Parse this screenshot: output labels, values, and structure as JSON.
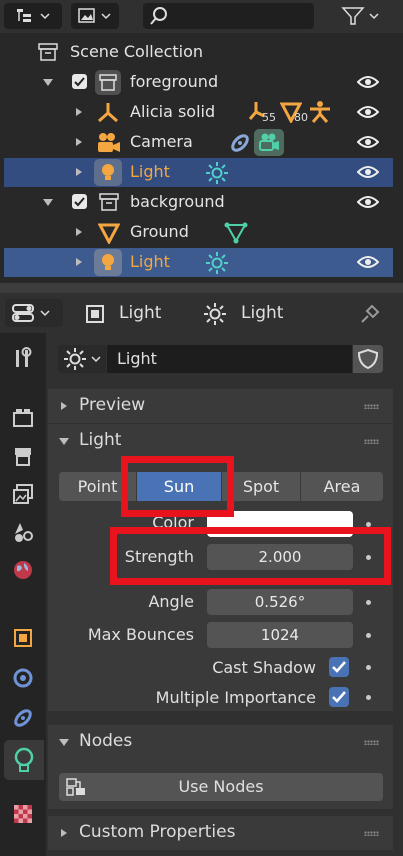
{
  "outliner": {
    "header": {
      "filter_label": ""
    },
    "rows": [
      {
        "label": "Scene Collection"
      },
      {
        "label": "foreground"
      },
      {
        "label": "Alicia solid",
        "badge1": "55",
        "badge2": "80"
      },
      {
        "label": "Camera"
      },
      {
        "label": "Light"
      },
      {
        "label": "background"
      },
      {
        "label": "Ground"
      },
      {
        "label": "Light"
      }
    ]
  },
  "properties": {
    "breadcrumb": {
      "object": "Light",
      "data": "Light"
    },
    "datablock_name": "Light",
    "panels": {
      "preview": "Preview",
      "light": "Light",
      "nodes": "Nodes",
      "custom": "Custom Properties"
    },
    "light_types": [
      "Point",
      "Sun",
      "Spot",
      "Area"
    ],
    "active_type": "Sun",
    "fields": {
      "color_label": "Color",
      "strength_label": "Strength",
      "strength_value": "2.000",
      "angle_label": "Angle",
      "angle_value": "0.526°",
      "bounces_label": "Max Bounces",
      "bounces_value": "1024",
      "cast_shadow_label": "Cast Shadow",
      "mis_label": "Multiple Importance"
    },
    "use_nodes_label": "Use Nodes"
  },
  "colors": {
    "selected_row": "#334d80",
    "accent_blue": "#4a73b5",
    "orange": "#f4a640",
    "highlight_red": "#e8131c"
  }
}
